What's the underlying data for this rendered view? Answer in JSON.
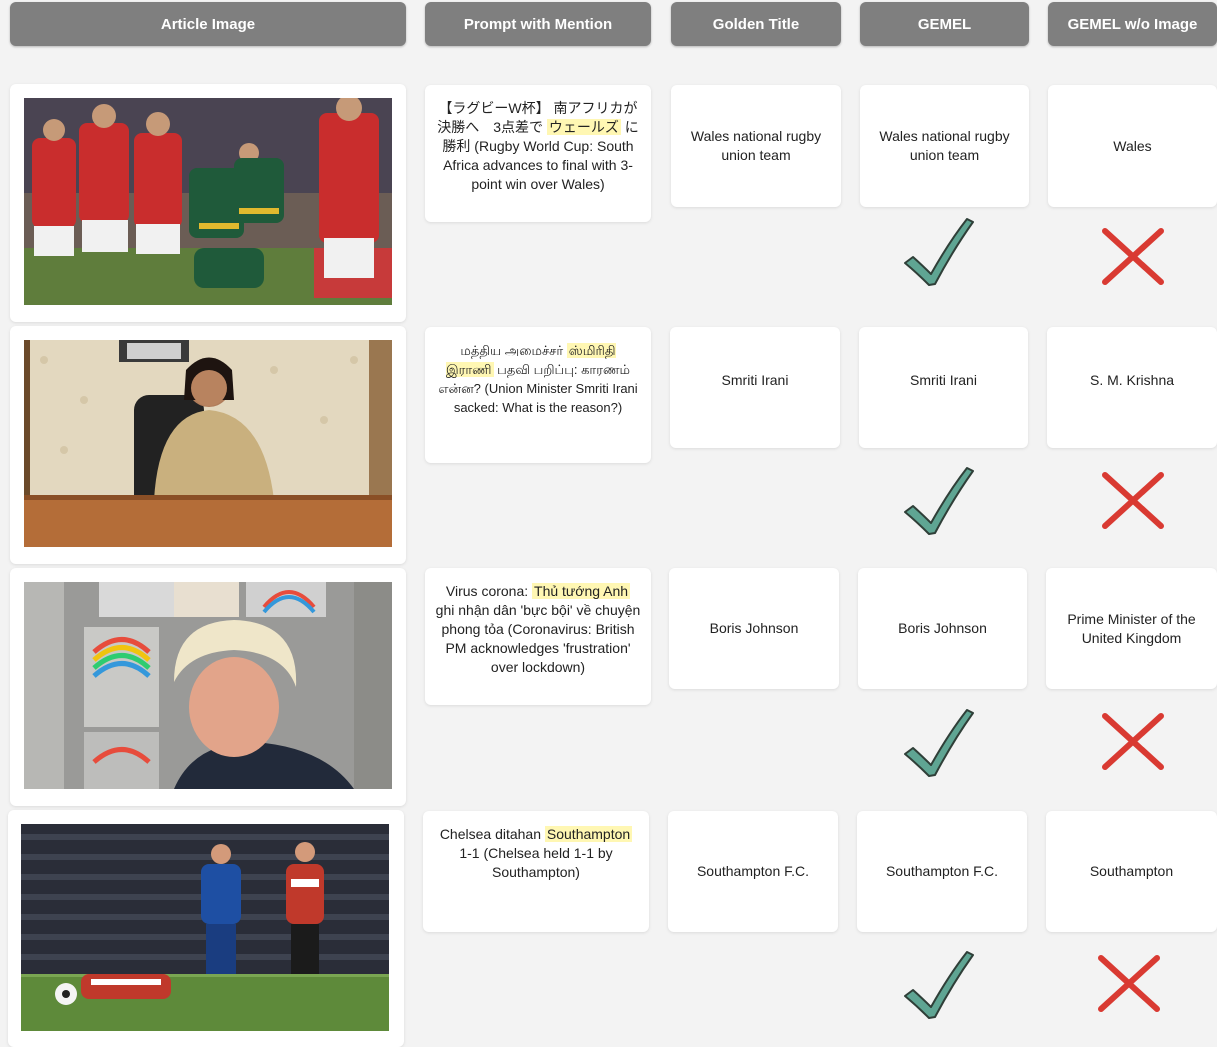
{
  "headers": {
    "article_image": "Article Image",
    "prompt": "Prompt with Mention",
    "golden": "Golden Title",
    "gemel": "GEMEL",
    "gemel_no_image": "GEMEL w/o Image"
  },
  "rows": [
    {
      "image": "rugby-match-photo",
      "prompt": {
        "pre": "【ラグビーW杯】 南アフリカが決勝へ　3点差で ",
        "mention": "ウェールズ",
        "post": " に勝利 (Rugby World Cup: South Africa advances to final with 3-point win over Wales)"
      },
      "golden": "Wales national rugby union team",
      "gemel": "Wales national rugby union team",
      "gemel_no_image": "Wales"
    },
    {
      "image": "politician-office-photo",
      "prompt": {
        "pre": "மத்திய அமைச்சர் ",
        "mention": "ஸ்மிரிதி இராணி",
        "post": " பதவி பறிப்பு: காரணம் என்ன? (Union Minister Smriti Irani sacked: What is the reason?)"
      },
      "golden": "Smriti Irani",
      "gemel": "Smriti Irani",
      "gemel_no_image": "S. M. Krishna"
    },
    {
      "image": "prime-minister-photo",
      "prompt": {
        "pre": "Virus corona: ",
        "mention": "Thủ tướng Anh",
        "post": " ghi nhận dân 'bực bội' về chuyện phong tỏa (Coronavirus: British PM acknowledges 'frustration' over lockdown)"
      },
      "golden": "Boris Johnson",
      "gemel": "Boris Johnson",
      "gemel_no_image": "Prime Minister of the United Kingdom"
    },
    {
      "image": "football-match-photo",
      "prompt": {
        "pre": "Chelsea ditahan ",
        "mention": "Southampton",
        "post": " 1-1 (Chelsea held 1-1 by Southampton)"
      },
      "golden": "Southampton F.C.",
      "gemel": "Southampton F.C.",
      "gemel_no_image": "Southampton"
    }
  ],
  "marks": {
    "correct": "check-icon",
    "wrong": "cross-icon"
  },
  "colors": {
    "header": "#7f7f7f",
    "check": "#5fa593",
    "cross": "#d93a32",
    "highlight": "#fff7b3"
  }
}
